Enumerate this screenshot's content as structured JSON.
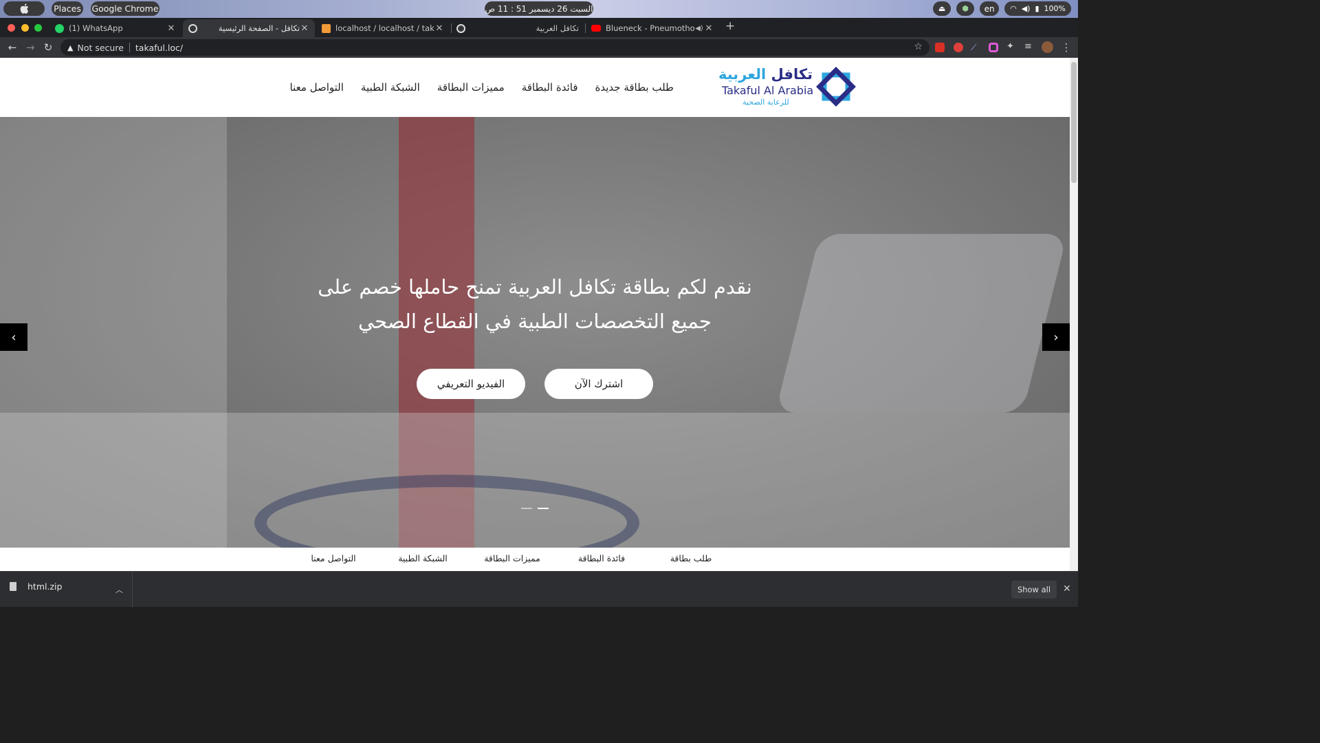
{
  "os": {
    "apple": "",
    "places": "Places",
    "app": "Google Chrome",
    "clock": "السبت 26 ديسمبر  51 : 11 ص",
    "lang": "en",
    "battery": "100%"
  },
  "tabs": [
    {
      "title": "(1) WhatsApp",
      "icon": "whatsapp-icon"
    },
    {
      "title": "تكافل - الصفحة الرئيسية",
      "icon": "globe-icon",
      "active": true
    },
    {
      "title": "localhost / localhost / takaful",
      "icon": "phpmyadmin-icon"
    },
    {
      "title": "تكافل العربية",
      "icon": "globe-icon"
    },
    {
      "title": "Blueneck - Pneumothorax",
      "icon": "youtube-icon"
    }
  ],
  "toolbar": {
    "not_secure": "Not secure",
    "url": "takaful.loc/"
  },
  "site": {
    "logo_ar_dark": "تكافل",
    "logo_ar_light": "العربية",
    "logo_en": "Takaful Al Arabia",
    "logo_sub": "للرعاية الصحية",
    "nav": [
      "طلب بطاقة جديدة",
      "فائدة البطاقة",
      "مميزات البطاقة",
      "الشبكة الطبية",
      "التواصل معنا"
    ],
    "hero_line1": "نقدم لكم بطاقة تكافل العربية تمنح حاملها خصم على",
    "hero_line2": "جميع التخصصات الطبية في القطاع الصحي",
    "btn_subscribe": "اشترك الآن",
    "btn_video": "الفيديو التعريفي",
    "subnav": [
      "طلب بطاقة",
      "فائدة البطاقة",
      "مميزات البطاقة",
      "الشبكة الطبية",
      "التواصل معنا"
    ],
    "slider_active_index": 1,
    "slider_count": 2
  },
  "downloads": {
    "file": "html.zip",
    "show_all": "Show all"
  },
  "colors": {
    "brand_dark": "#2a2d86",
    "brand_light": "#2ea6de"
  }
}
